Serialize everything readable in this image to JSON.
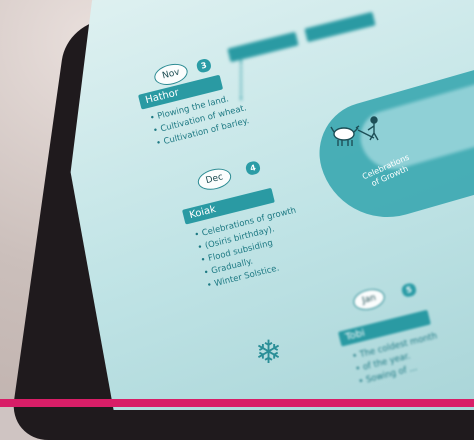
{
  "cards": [
    {
      "month": "Nov",
      "num": "3",
      "name": "Hathor",
      "items": [
        "Plowing the land.",
        "Cultivation of wheat.",
        "Cultivation of barley."
      ]
    },
    {
      "month": "Dec",
      "num": "4",
      "name": "Koiak",
      "items": [
        "Celebrations of growth",
        "(Osiris birthday).",
        "Flood subsiding",
        "Gradually.",
        "Winter Solstice."
      ]
    },
    {
      "month": "Jan",
      "num": "5",
      "name": "Tobi",
      "items": [
        "The coldest month",
        "of the year.",
        "Sowing of ..."
      ]
    }
  ],
  "river_label": "Celebrations of Growth",
  "colors": {
    "teal": "#2a9aa3",
    "page": "#cfeaeb",
    "strip": "#d81e67",
    "cover": "#1f1a1d"
  },
  "icons": [
    "snowflake-icon",
    "farmer-ox-plow-icon"
  ]
}
